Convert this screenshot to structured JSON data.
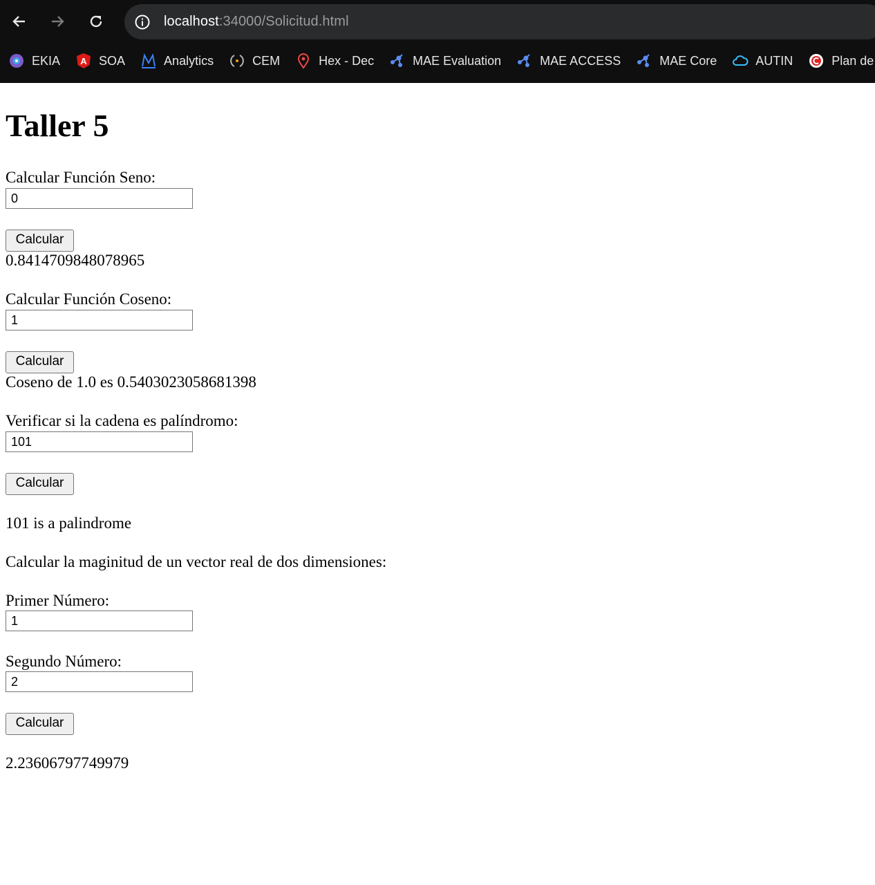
{
  "browser": {
    "url_host": "localhost",
    "url_rest": ":34000/Solicitud.html",
    "bookmarks": [
      {
        "label": "EKIA",
        "icon": "ekia-icon"
      },
      {
        "label": "SOA",
        "icon": "angular-icon"
      },
      {
        "label": "Analytics",
        "icon": "analytics-icon"
      },
      {
        "label": "CEM",
        "icon": "cem-icon"
      },
      {
        "label": "Hex - Dec",
        "icon": "map-pin-icon"
      },
      {
        "label": "MAE Evaluation",
        "icon": "mae-icon"
      },
      {
        "label": "MAE ACCESS",
        "icon": "mae-icon"
      },
      {
        "label": "MAE Core",
        "icon": "mae-icon"
      },
      {
        "label": "AUTIN",
        "icon": "cloud-icon"
      },
      {
        "label": "Plan de",
        "icon": "plan-icon"
      }
    ]
  },
  "page": {
    "title": "Taller 5",
    "seno": {
      "label": "Calcular Función Seno:",
      "value": "0",
      "button": "Calcular",
      "result": "0.8414709848078965"
    },
    "coseno": {
      "label": "Calcular Función Coseno:",
      "value": "1",
      "button": "Calcular",
      "result": "Coseno de 1.0 es 0.5403023058681398"
    },
    "palindromo": {
      "label": "Verificar si la cadena es palíndromo:",
      "value": "101",
      "button": "Calcular",
      "result": "101 is a palindrome"
    },
    "magnitud": {
      "label": "Calcular la maginitud de un vector real de dos dimensiones:",
      "first_label": "Primer Número:",
      "first_value": "1",
      "second_label": "Segundo Número:",
      "second_value": "2",
      "button": "Calcular",
      "result": "2.23606797749979"
    }
  }
}
